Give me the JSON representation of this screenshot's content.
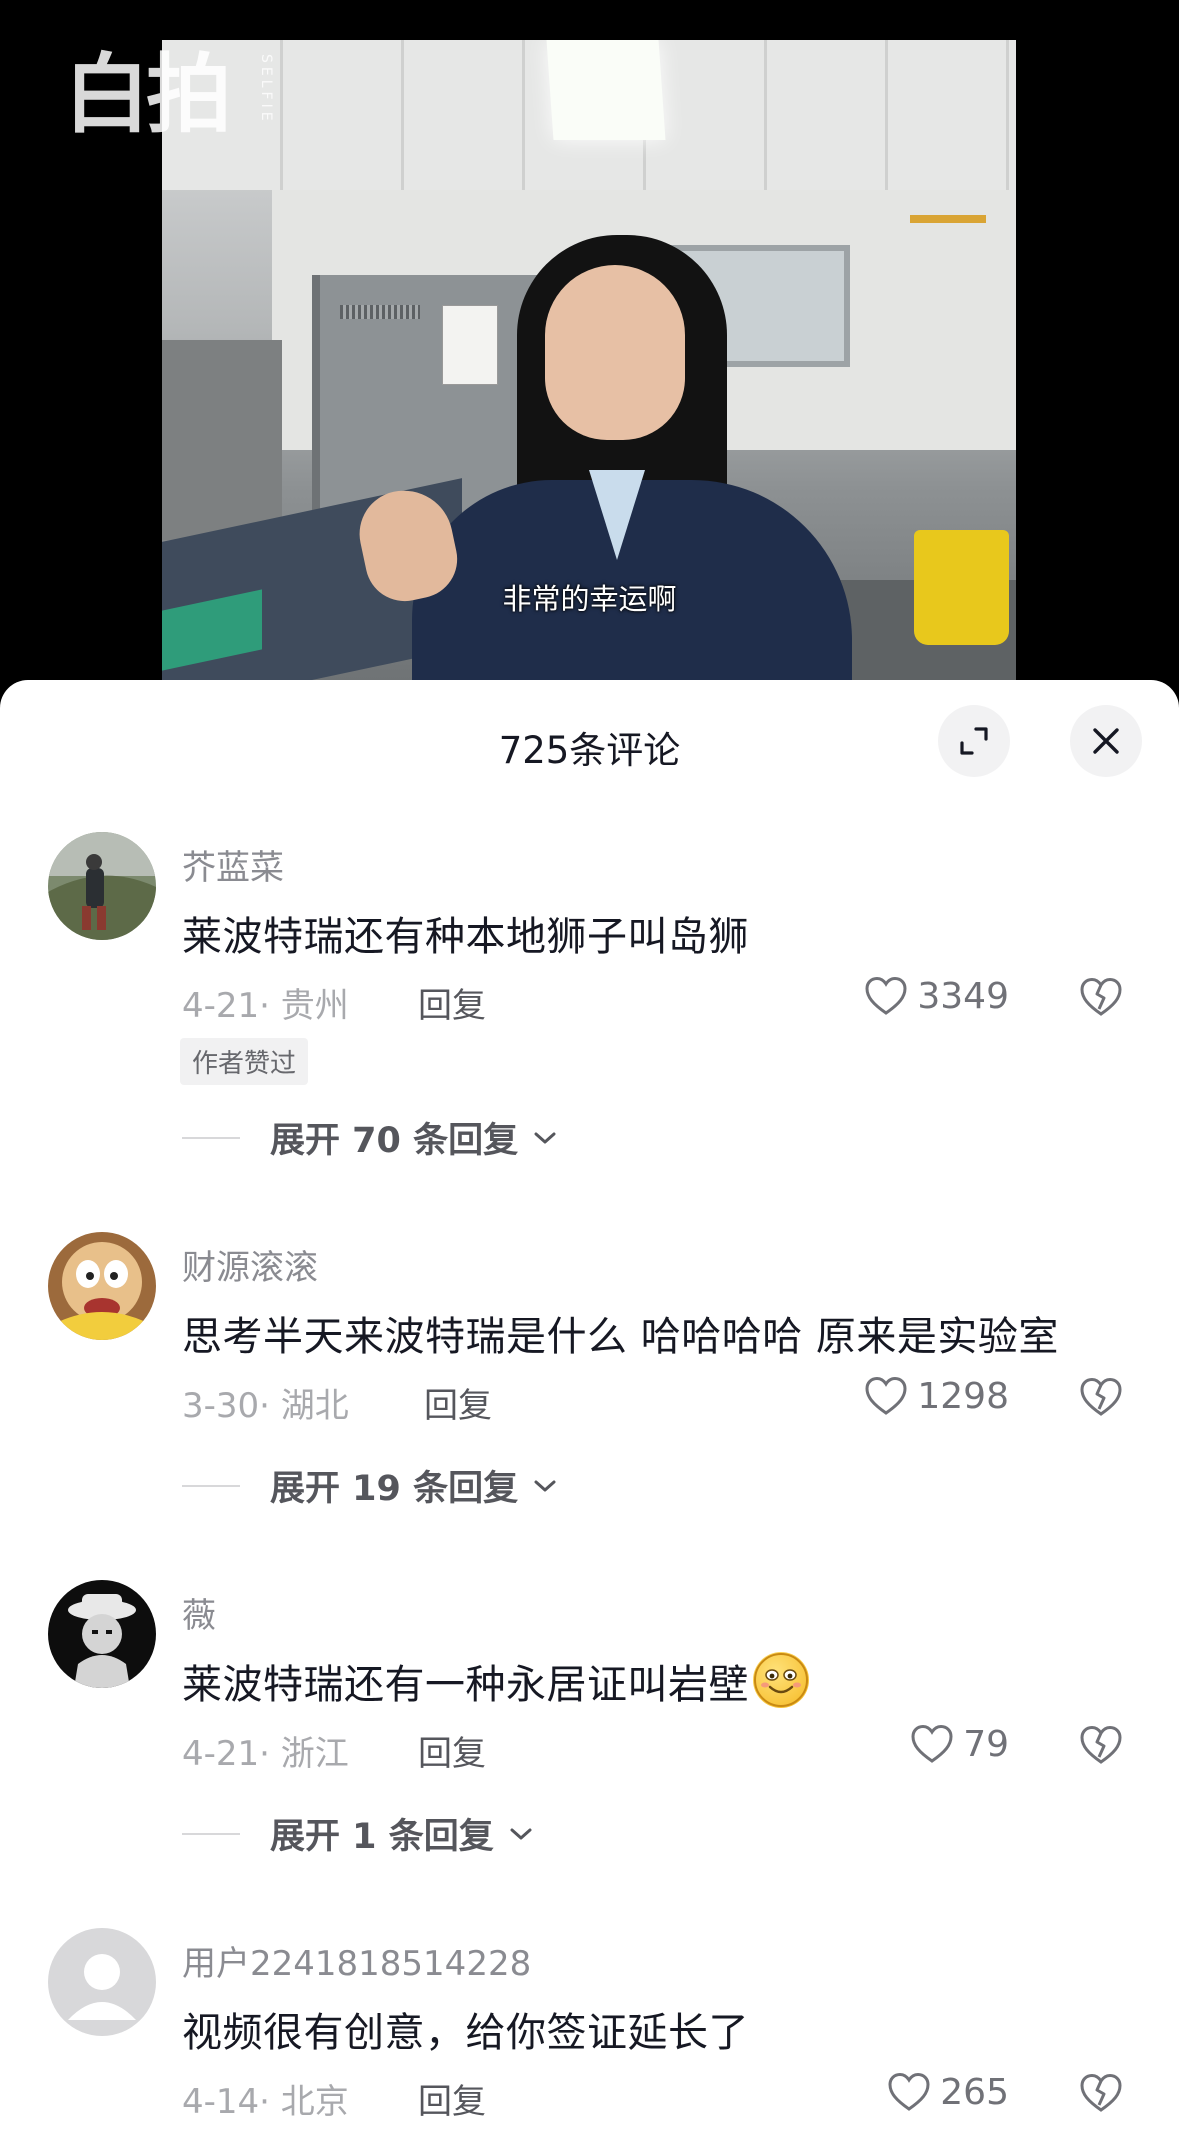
{
  "video": {
    "watermark": "白拍",
    "watermark_sub": "SELFIE",
    "subtitle": "非常的幸运啊"
  },
  "comments_panel": {
    "title": "725条评论",
    "expand_icon": "expand-icon",
    "close_icon": "close-icon",
    "comments": [
      {
        "author": "芥蓝菜",
        "text": "莱波特瑞还有种本地狮子叫岛狮",
        "date_location": "4-21· 贵州",
        "reply_label": "回复",
        "likes": "3349",
        "badge": "作者赞过",
        "expand_label": "展开 70 条回复"
      },
      {
        "author": "财源滚滚",
        "text": "思考半天来波特瑞是什么 哈哈哈哈 原来是实验室",
        "date_location": "3-30· 湖北",
        "reply_label": "回复",
        "likes": "1298",
        "expand_label": "展开 19 条回复"
      },
      {
        "author": "薇",
        "text": "莱波特瑞还有一种永居证叫岩壁",
        "date_location": "4-21· 浙江",
        "reply_label": "回复",
        "likes": "79",
        "expand_label": "展开 1 条回复"
      },
      {
        "author": "用户2241818514228",
        "text": "视频很有创意，给你签证延长了",
        "date_location": "4-14· 北京",
        "reply_label": "回复",
        "likes": "265"
      }
    ]
  },
  "colors": {
    "sheet_background": "#ffffff",
    "primary_text": "#161823",
    "secondary_text": "#8a8b91",
    "video_background": "#000000"
  }
}
